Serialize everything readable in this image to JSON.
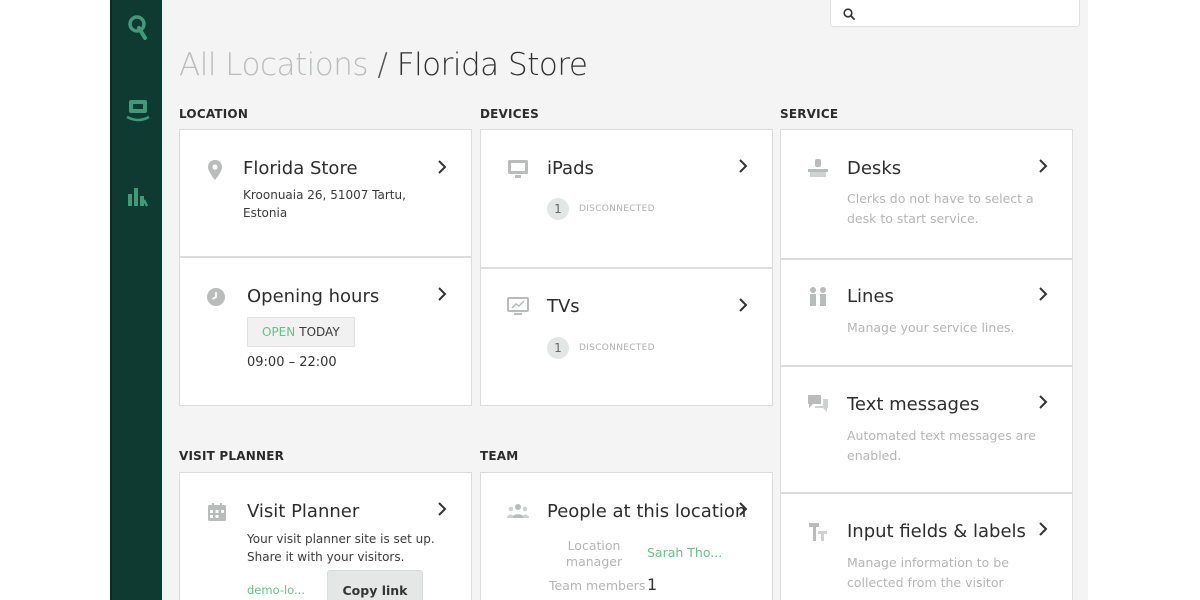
{
  "search": {
    "placeholder": ""
  },
  "header": {
    "crumb": "All Locations",
    "separator": "/",
    "current": "Florida Store"
  },
  "sections": {
    "location": "LOCATION",
    "devices": "DEVICES",
    "service": "SERVICE",
    "visit_planner": "VISIT PLANNER",
    "team": "TEAM"
  },
  "location": {
    "store": {
      "title": "Florida Store",
      "address": "Kroonuaia 26, 51007 Tartu, Estonia"
    },
    "hours": {
      "title": "Opening hours",
      "open_word": "OPEN",
      "today_word": "TODAY",
      "range": "09:00 – 22:00"
    }
  },
  "devices": {
    "ipads": {
      "title": "iPads",
      "count": "1",
      "status": "DISCONNECTED"
    },
    "tvs": {
      "title": "TVs",
      "count": "1",
      "status": "DISCONNECTED"
    }
  },
  "service": {
    "desks": {
      "title": "Desks",
      "desc": "Clerks do not have to select a desk to start service."
    },
    "lines": {
      "title": "Lines",
      "desc": "Manage your service lines."
    },
    "texts": {
      "title": "Text messages",
      "desc": "Automated text messages are enabled."
    },
    "fields": {
      "title": "Input fields & labels",
      "desc": "Manage information to be collected from the visitor"
    }
  },
  "visit_planner": {
    "title": "Visit Planner",
    "desc": "Your visit planner site is set up. Share it with your visitors.",
    "link": "demo-lo...",
    "copy_label": "Copy link"
  },
  "team": {
    "title": "People at this location",
    "manager_label": "Location manager",
    "manager_value": "Sarah Tho...",
    "members_label": "Team members",
    "members_value": "1"
  },
  "colors": {
    "sidebar": "#0f3a32",
    "accent": "#5fc48a",
    "background": "#f4f4f4"
  }
}
